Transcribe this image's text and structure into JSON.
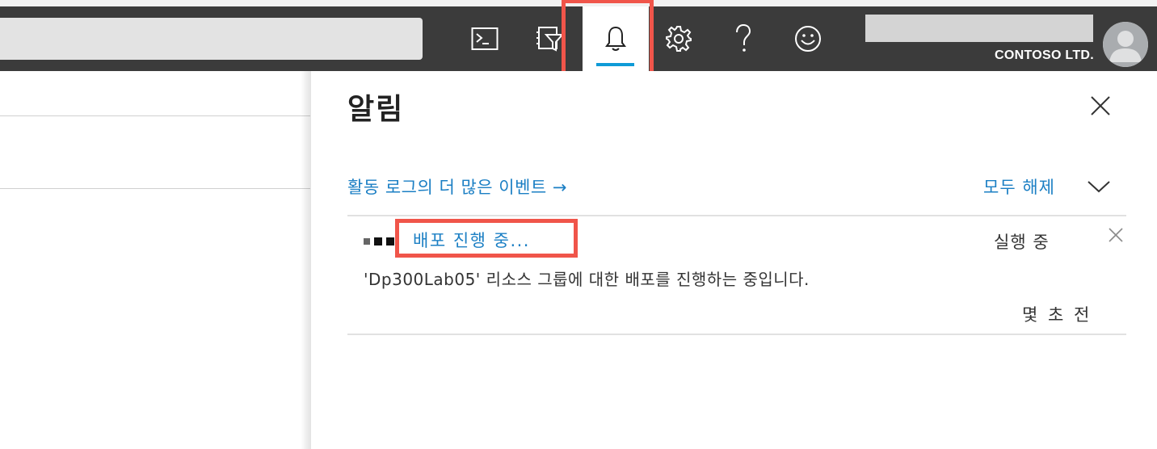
{
  "topbar": {
    "icons": {
      "cloud_shell": "cloud-shell-icon",
      "directory_filter": "directory-filter-icon",
      "notifications": "bell-icon",
      "settings": "gear-icon",
      "help": "help-icon",
      "feedback": "smiley-icon"
    },
    "org_name": "CONTOSO LTD.",
    "colors": {
      "bar": "#3b3b3b",
      "accent": "#0f9bd7",
      "highlight": "#f0554a"
    }
  },
  "panel": {
    "title": "알림",
    "activity_log_link": "활동 로그의 더 많은 이벤트 →",
    "dismiss_all": "모두 해제",
    "notification": {
      "title": "배포 진행 중...",
      "status": "실행 중",
      "description": "'Dp300Lab05' 리소스 그룹에 대한 배포를 진행하는 중입니다.",
      "time": "몇 초 전"
    }
  }
}
